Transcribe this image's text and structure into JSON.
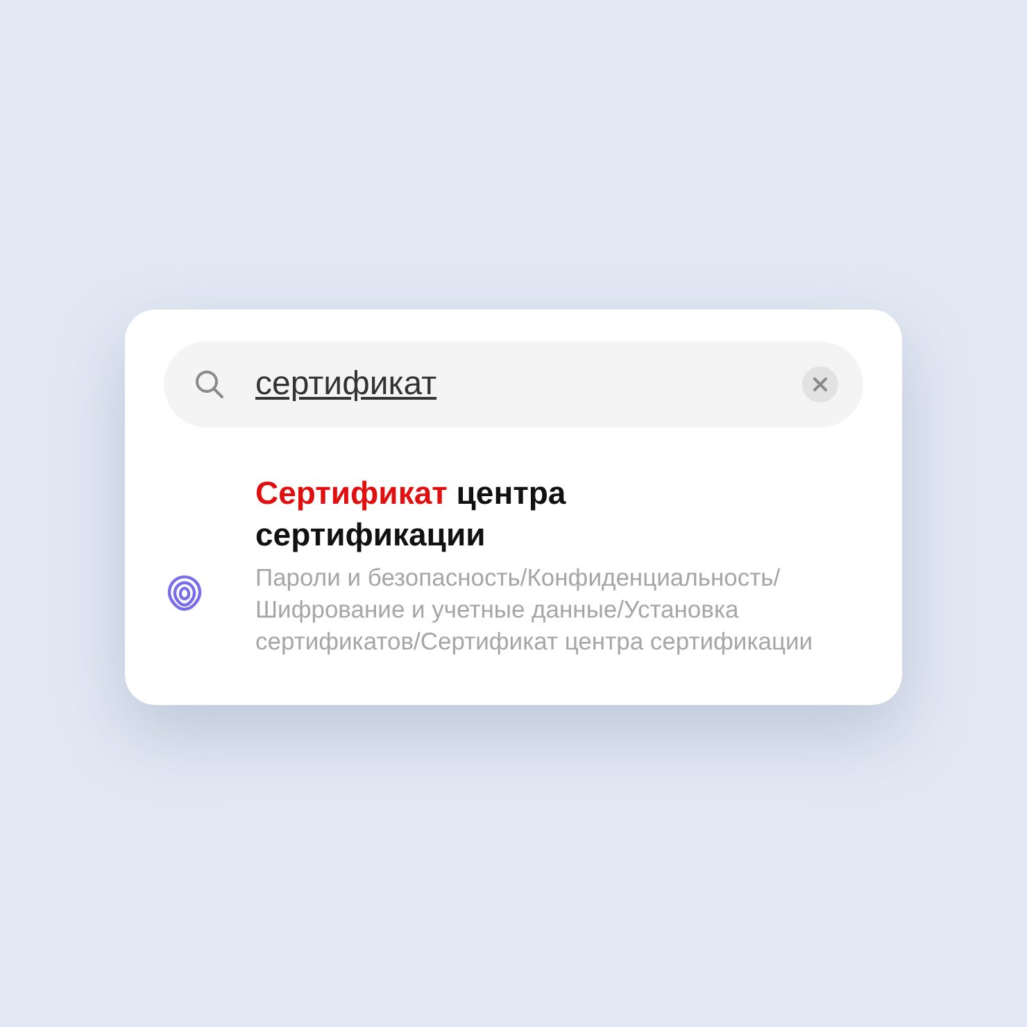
{
  "search": {
    "value": "сертификат"
  },
  "results": [
    {
      "title_match": "Сертификат",
      "title_rest": " центра сертификации",
      "path": "Пароли и безопасность/Конфиденциальность/ Шифрование и учетные данные/Установка сертификатов/Сертификат центра сертификации"
    }
  ]
}
